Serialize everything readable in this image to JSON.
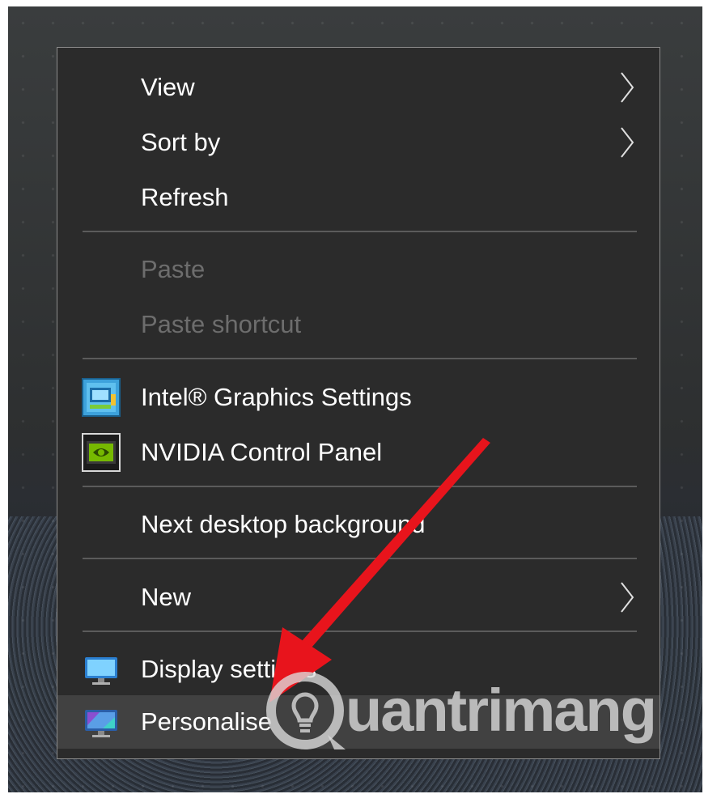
{
  "context_menu": {
    "items": [
      {
        "label": "View",
        "enabled": true,
        "has_submenu": true,
        "icon": null
      },
      {
        "label": "Sort by",
        "enabled": true,
        "has_submenu": true,
        "icon": null
      },
      {
        "label": "Refresh",
        "enabled": true,
        "has_submenu": false,
        "icon": null
      },
      {
        "label": "Paste",
        "enabled": false,
        "has_submenu": false,
        "icon": null
      },
      {
        "label": "Paste shortcut",
        "enabled": false,
        "has_submenu": false,
        "icon": null
      },
      {
        "label": "Intel® Graphics Settings",
        "enabled": true,
        "has_submenu": false,
        "icon": "intel-graphics-icon"
      },
      {
        "label": "NVIDIA Control Panel",
        "enabled": true,
        "has_submenu": false,
        "icon": "nvidia-icon"
      },
      {
        "label": "Next desktop background",
        "enabled": true,
        "has_submenu": false,
        "icon": null
      },
      {
        "label": "New",
        "enabled": true,
        "has_submenu": true,
        "icon": null
      },
      {
        "label": "Display settings",
        "enabled": true,
        "has_submenu": false,
        "icon": "display-monitor-icon"
      },
      {
        "label": "Personalise",
        "enabled": true,
        "has_submenu": false,
        "icon": "personalise-icon",
        "highlighted": true
      }
    ]
  },
  "watermark": {
    "text": "uantrimang"
  },
  "colors": {
    "menu_bg": "#2b2b2b",
    "menu_text": "#ffffff",
    "disabled_text": "#6d6d6d",
    "highlight_bg": "#414141",
    "arrow": "#e8141c"
  }
}
